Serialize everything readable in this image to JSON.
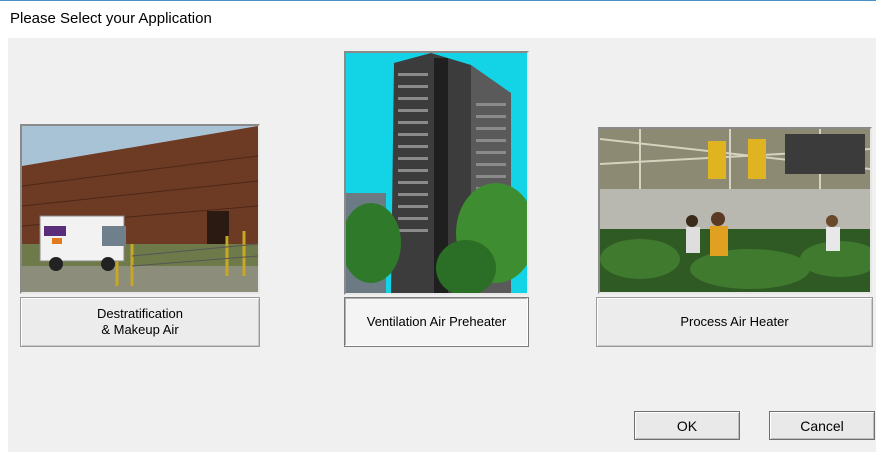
{
  "window": {
    "title": "Please Select your Application"
  },
  "applications": [
    {
      "label": "Destratification\n& Makeup Air",
      "image": "delivery-truck-warehouse-photo",
      "selected": false
    },
    {
      "label": "Ventilation Air Preheater",
      "image": "high-rise-building-photo",
      "selected": true
    },
    {
      "label": "Process Air Heater",
      "image": "greenhouse-workers-photo",
      "selected": false
    }
  ],
  "buttons": {
    "ok": "OK",
    "cancel": "Cancel"
  },
  "colors": {
    "window_bg": "#f0f0f0",
    "title_border": "#4a90c8"
  }
}
